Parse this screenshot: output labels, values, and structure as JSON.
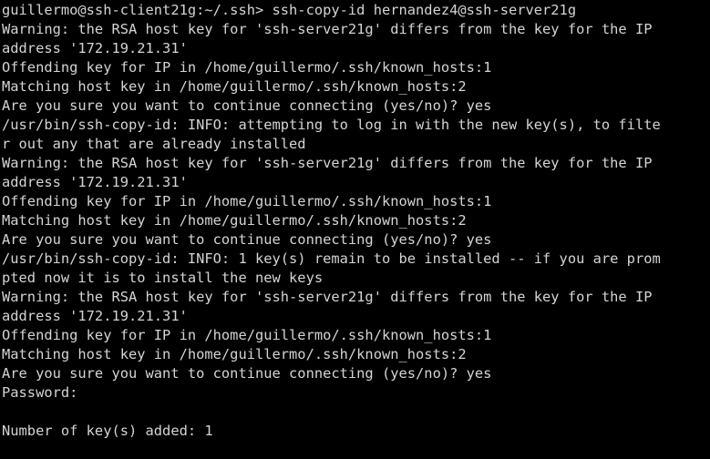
{
  "terminal": {
    "lines": [
      "guillermo@ssh-client21g:~/.ssh> ssh-copy-id hernandez4@ssh-server21g",
      "Warning: the RSA host key for 'ssh-server21g' differs from the key for the IP",
      "address '172.19.21.31'",
      "Offending key for IP in /home/guillermo/.ssh/known_hosts:1",
      "Matching host key in /home/guillermo/.ssh/known_hosts:2",
      "Are you sure you want to continue connecting (yes/no)? yes",
      "/usr/bin/ssh-copy-id: INFO: attempting to log in with the new key(s), to filte",
      "r out any that are already installed",
      "Warning: the RSA host key for 'ssh-server21g' differs from the key for the IP",
      "address '172.19.21.31'",
      "Offending key for IP in /home/guillermo/.ssh/known_hosts:1",
      "Matching host key in /home/guillermo/.ssh/known_hosts:2",
      "Are you sure you want to continue connecting (yes/no)? yes",
      "/usr/bin/ssh-copy-id: INFO: 1 key(s) remain to be installed -- if you are prom",
      "pted now it is to install the new keys",
      "Warning: the RSA host key for 'ssh-server21g' differs from the key for the IP",
      "address '172.19.21.31'",
      "Offending key for IP in /home/guillermo/.ssh/known_hosts:1",
      "Matching host key in /home/guillermo/.ssh/known_hosts:2",
      "Are you sure you want to continue connecting (yes/no)? yes",
      "Password:",
      "",
      "Number of key(s) added: 1"
    ]
  },
  "colors": {
    "background": "#000000",
    "foreground": "#d4d4d4"
  }
}
